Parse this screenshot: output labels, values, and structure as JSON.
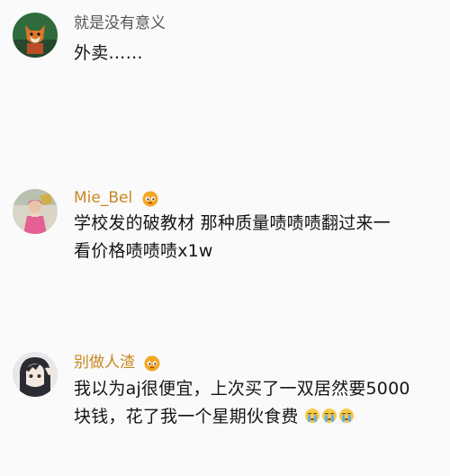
{
  "comments": [
    {
      "username": "就是没有意义",
      "username_color": "#555555",
      "has_badge": false,
      "text_lines": [
        "外卖……"
      ],
      "avatar_icon": "fox-cartoon-avatar"
    },
    {
      "username": "Mie_Bel",
      "username_color": "#c8881f",
      "has_badge": true,
      "badge_icon": "vip-crown-badge-icon",
      "text_lines": [
        "学校发的破教材 那种质量啧啧啧翻过来一",
        "看价格啧啧啧x1w"
      ],
      "avatar_icon": "pink-dressed-figure-avatar"
    },
    {
      "username": "别做人渣",
      "username_color": "#c8881f",
      "has_badge": true,
      "badge_icon": "vip-crown-badge-icon",
      "text_lines": [
        "我以为aj很便宜，上次买了一双居然要5000",
        "块钱，花了我一个星期伙食费"
      ],
      "trailing_emoji": [
        "crying-face-emoji",
        "crying-face-emoji",
        "crying-face-emoji"
      ],
      "avatar_icon": "anime-girl-avatar"
    }
  ]
}
